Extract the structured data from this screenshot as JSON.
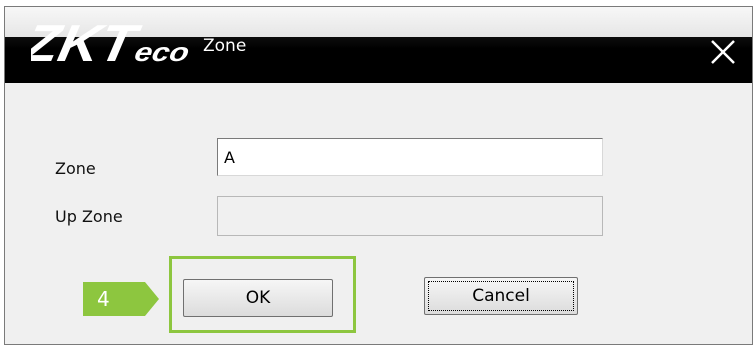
{
  "window": {
    "logo_text": "ZKTeco",
    "title": "Zone",
    "close_icon": "close-x-icon"
  },
  "form": {
    "zone_label": "Zone",
    "zone_value": "A",
    "up_zone_label": "Up Zone",
    "up_zone_value": ""
  },
  "buttons": {
    "ok_label": "OK",
    "cancel_label": "Cancel"
  },
  "annotation": {
    "step_number": "4",
    "highlight_color": "#8dc63f"
  }
}
